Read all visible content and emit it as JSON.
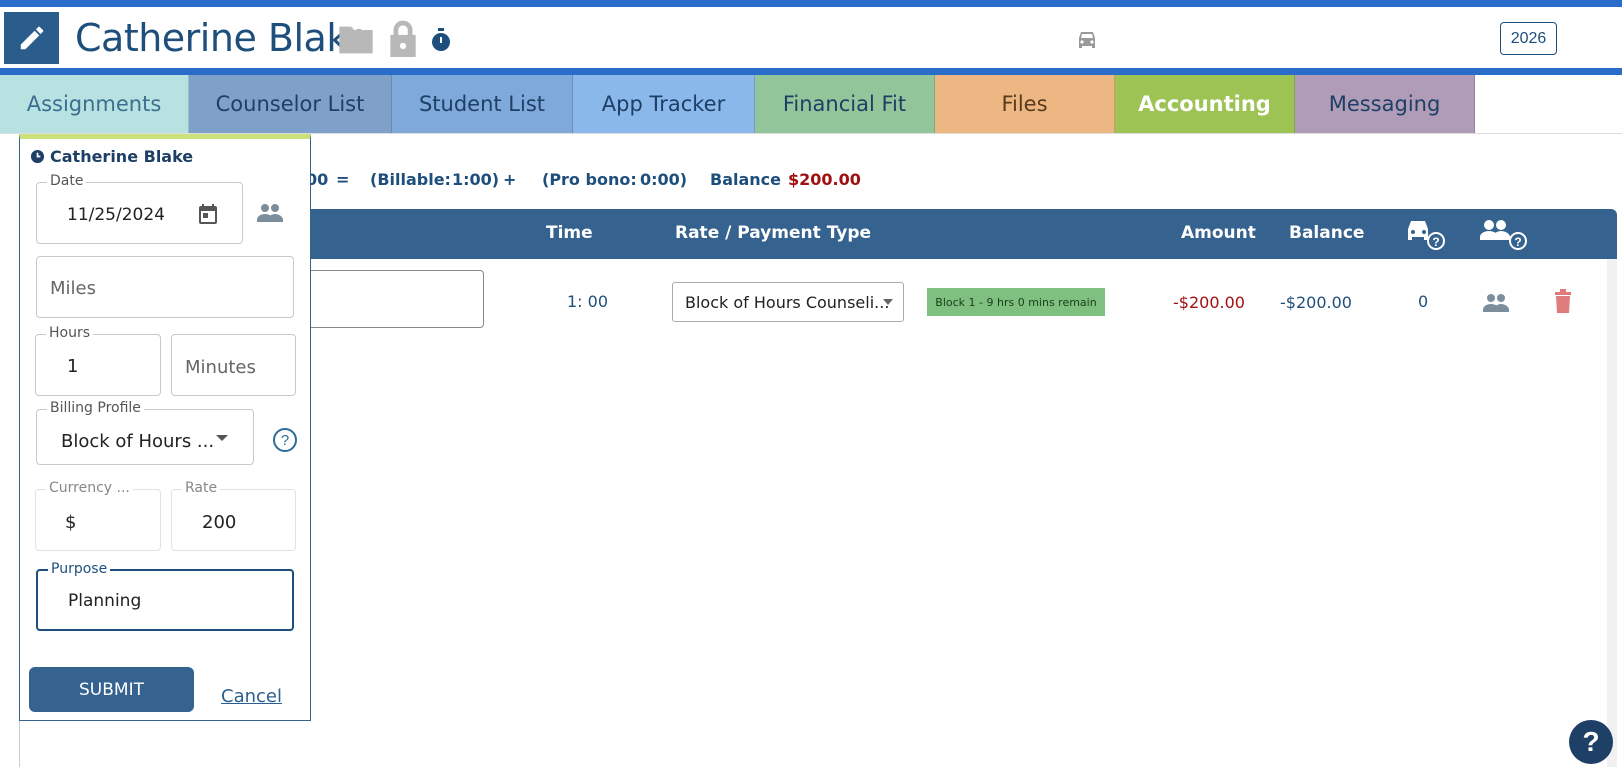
{
  "header": {
    "name": "Catherine Blake",
    "year": "2026",
    "icons": [
      "edit-icon",
      "folder-icon",
      "lock-icon",
      "stopwatch-icon",
      "car-icon"
    ]
  },
  "tabs": [
    {
      "label": "Assignments",
      "color": "#b7e2e1",
      "text": "#3c6e8f"
    },
    {
      "label": "Counselor List",
      "color": "#7fa1c9",
      "text": "#1e3f66"
    },
    {
      "label": "Student List",
      "color": "#7fa9da",
      "text": "#1e3f66"
    },
    {
      "label": "App Tracker",
      "color": "#8ab8ea",
      "text": "#1e3f66"
    },
    {
      "label": "Financial Fit",
      "color": "#92c69a",
      "text": "#1e3f66"
    },
    {
      "label": "Files",
      "color": "#ecb782",
      "text": "#5a3a1a"
    },
    {
      "label": "Accounting",
      "color": "#9cc354",
      "text": "#ffffff"
    },
    {
      "label": "Messaging",
      "color": "#b19cb8",
      "text": "#1e3f66"
    }
  ],
  "summary": {
    "total_fragment": "00",
    "equals": "=",
    "billable_label": "(Billable:",
    "billable_value": "1:00)",
    "plus": "+",
    "probono_label": "(Pro bono:",
    "probono_value": "0:00)",
    "balance_label": "Balance",
    "balance_value": "$200.00"
  },
  "table": {
    "headers": {
      "time": "Time",
      "rate": "Rate / Payment Type",
      "amount": "Amount",
      "balance": "Balance"
    },
    "row": {
      "time": "1: 00",
      "rate_select": "Block of Hours Counseli...",
      "block_badge": "Block 1 - 9 hrs 0 mins remain",
      "amount": "-$200.00",
      "balance": "-$200.00",
      "miles": "0"
    }
  },
  "panel": {
    "title": "Catherine Blake",
    "date_label": "Date",
    "date_value": "11/25/2024",
    "miles_placeholder": "Miles",
    "hours_label": "Hours",
    "hours_value": "1",
    "minutes_placeholder": "Minutes",
    "billing_label": "Billing Profile",
    "billing_value": "Block of Hours ...",
    "currency_label": "Currency ...",
    "currency_value": "$",
    "rate_label": "Rate",
    "rate_value": "200",
    "purpose_label": "Purpose",
    "purpose_value": "Planning",
    "submit_label": "SUBMIT",
    "cancel_label": "Cancel"
  },
  "help_label": "?"
}
